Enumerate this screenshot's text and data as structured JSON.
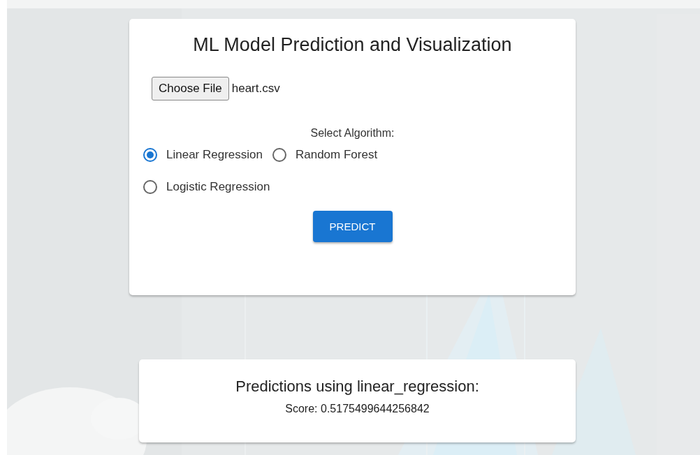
{
  "title": "ML Model Prediction and Visualization",
  "file": {
    "button_label": "Choose File",
    "file_name": "heart.csv"
  },
  "algorithm": {
    "label": "Select Algorithm:",
    "options": [
      {
        "label": "Linear Regression",
        "selected": true
      },
      {
        "label": "Random Forest",
        "selected": false
      },
      {
        "label": "Logistic Regression",
        "selected": false
      }
    ]
  },
  "predict_button": "PREDICT",
  "result": {
    "heading": "Predictions using linear_regression:",
    "score": "Score: 0.5175499644256842"
  }
}
